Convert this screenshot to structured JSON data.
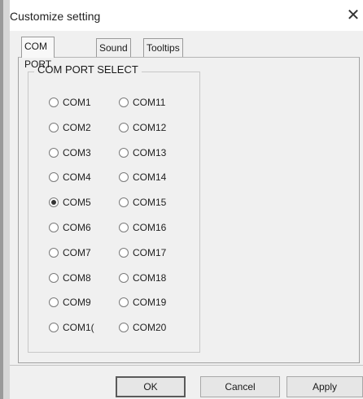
{
  "window": {
    "title": "Customize setting",
    "close_glyph": "✕"
  },
  "tabs": [
    {
      "label": "COM PORT",
      "active": true
    },
    {
      "label": "Sound",
      "active": false
    },
    {
      "label": "Tooltips",
      "active": false
    }
  ],
  "group": {
    "label": "COM PORT SELECT"
  },
  "ports_left": [
    "COM1",
    "COM2",
    "COM3",
    "COM4",
    "COM5",
    "COM6",
    "COM7",
    "COM8",
    "COM9",
    "COM1("
  ],
  "ports_right": [
    "COM11",
    "COM12",
    "COM13",
    "COM14",
    "COM15",
    "COM16",
    "COM17",
    "COM18",
    "COM19",
    "COM20"
  ],
  "selected_port": "COM5",
  "buttons": {
    "ok": "OK",
    "cancel": "Cancel",
    "apply": "Apply"
  },
  "icons": {
    "close": "close-icon"
  }
}
